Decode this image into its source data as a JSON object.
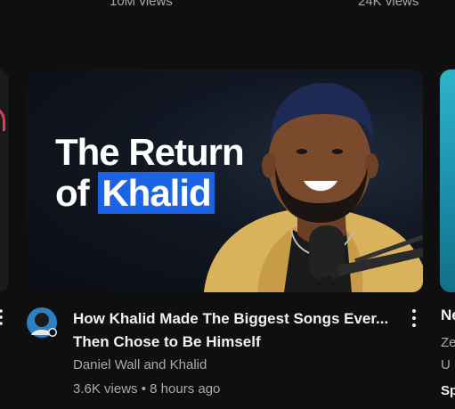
{
  "previous_row": {
    "left_views": "10M views",
    "right_views": "24K views"
  },
  "video": {
    "thumbnail_text_line1": "The Return",
    "thumbnail_text_line2_prefix": "of",
    "thumbnail_text_line2_highlight": "Khalid",
    "title": "How Khalid Made The Biggest Songs Ever... Then Chose to Be Himself",
    "channel": "Daniel Wall and Khalid",
    "views": "3.6K views",
    "separator": "•",
    "age": "8 hours ago",
    "menu_icon": "more-vert-icon",
    "highlight_color": "#1d63e5"
  },
  "next_video_partial": {
    "title": "Ne",
    "meta_line1": "Ze",
    "meta_line2": "U",
    "meta_line3": "Sp"
  },
  "colors": {
    "background": "#0f0f0f",
    "primary_text": "#f1f1f1",
    "secondary_text": "#aaaaaa"
  }
}
